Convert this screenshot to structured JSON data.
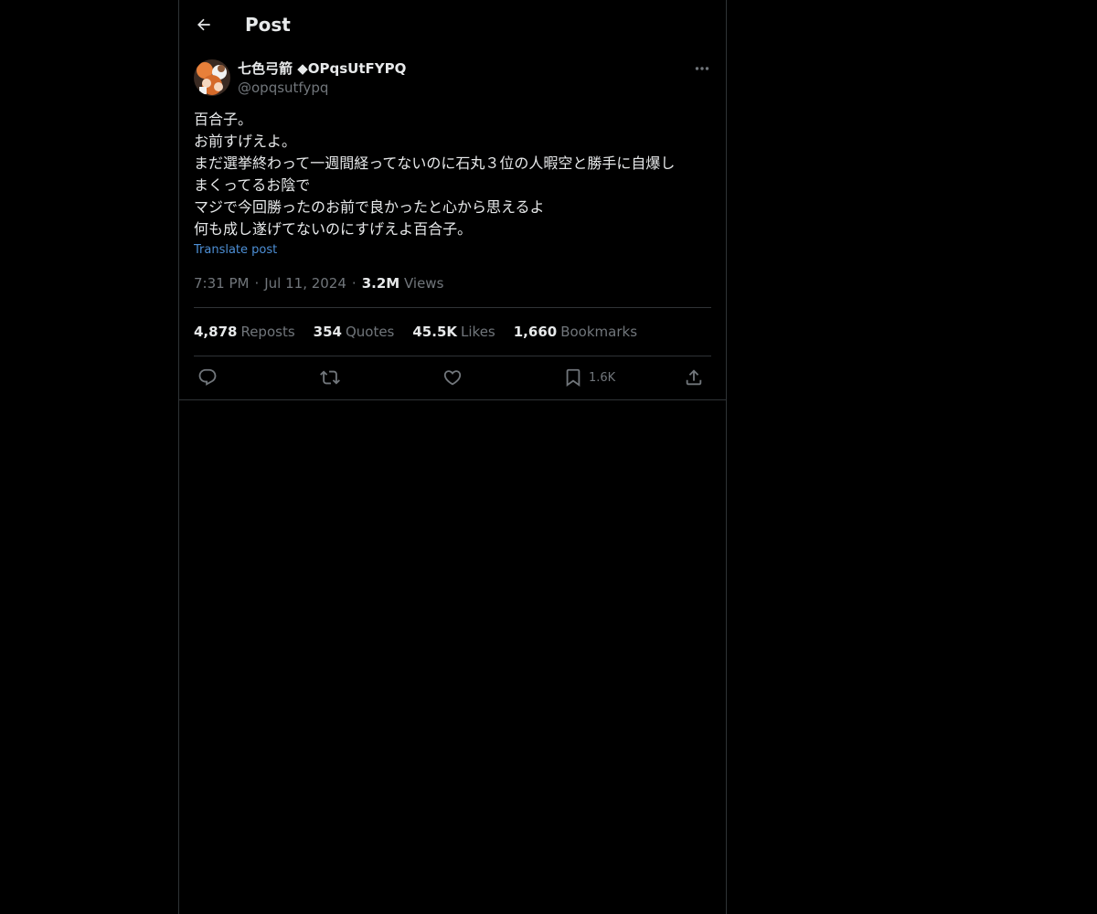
{
  "header": {
    "title": "Post"
  },
  "post": {
    "author": {
      "display_name": "七色弓箭 ◆OPqsUtFYPQ",
      "handle": "@opqsutfypq"
    },
    "text_lines": [
      "百合子。",
      "お前すげえよ。",
      "まだ選挙終わって一週間経ってないのに石丸３位の人暇空と勝手に自爆し",
      "まくってるお陰で",
      "マジで今回勝ったのお前で良かったと心から思えるよ",
      "何も成し遂げてないのにすげえよ百合子。"
    ],
    "translate_label": "Translate post",
    "time": "7:31 PM",
    "date": "Jul 11, 2024",
    "views_count": "3.2M",
    "views_label": "Views",
    "stats": {
      "reposts": {
        "count": "4,878",
        "label": "Reposts"
      },
      "quotes": {
        "count": "354",
        "label": "Quotes"
      },
      "likes": {
        "count": "45.5K",
        "label": "Likes"
      },
      "bookmarks": {
        "count": "1,660",
        "label": "Bookmarks"
      }
    },
    "actions": {
      "reply_icon": "reply-icon",
      "repost_icon": "repost-icon",
      "like_icon": "heart-icon",
      "bookmark_icon": "bookmark-icon",
      "bookmark_count": "1.6K",
      "share_icon": "share-icon"
    }
  },
  "colors": {
    "background": "#000000",
    "text_primary": "#e7e9ea",
    "text_secondary": "#71767b",
    "link": "#4d8fd6",
    "border": "#2f3336"
  }
}
